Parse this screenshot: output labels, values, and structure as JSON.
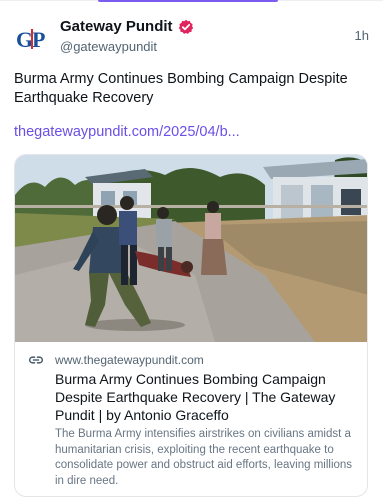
{
  "post": {
    "author": {
      "display_name": "Gateway Pundit",
      "handle": "@gatewaypundit",
      "avatar_text": "GP",
      "verified": true
    },
    "timestamp": "1h",
    "text": "Burma Army Continues Bombing Campaign Despite Earthquake Recovery",
    "link_text": "thegatewaypundit.com/2025/04/b..."
  },
  "card": {
    "domain": "www.thegatewaypundit.com",
    "title": "Burma Army Continues Bombing Campaign Despite Earthquake Recovery | The Gateway Pundit | by Antonio Graceffo",
    "description": "The Burma Army intensifies airstrikes on civilians amidst a humanitarian crisis, exploiting the recent earthquake to consolidate power and obstruct aid efforts, leaving millions in dire need."
  },
  "colors": {
    "link": "#6b4fe6",
    "verified_badge": "#e0245e",
    "avatar_brand": "#1a4f9c",
    "avatar_accent": "#d82b2b"
  },
  "icons": {
    "verified": "verified-badge-icon",
    "link": "link-icon"
  }
}
